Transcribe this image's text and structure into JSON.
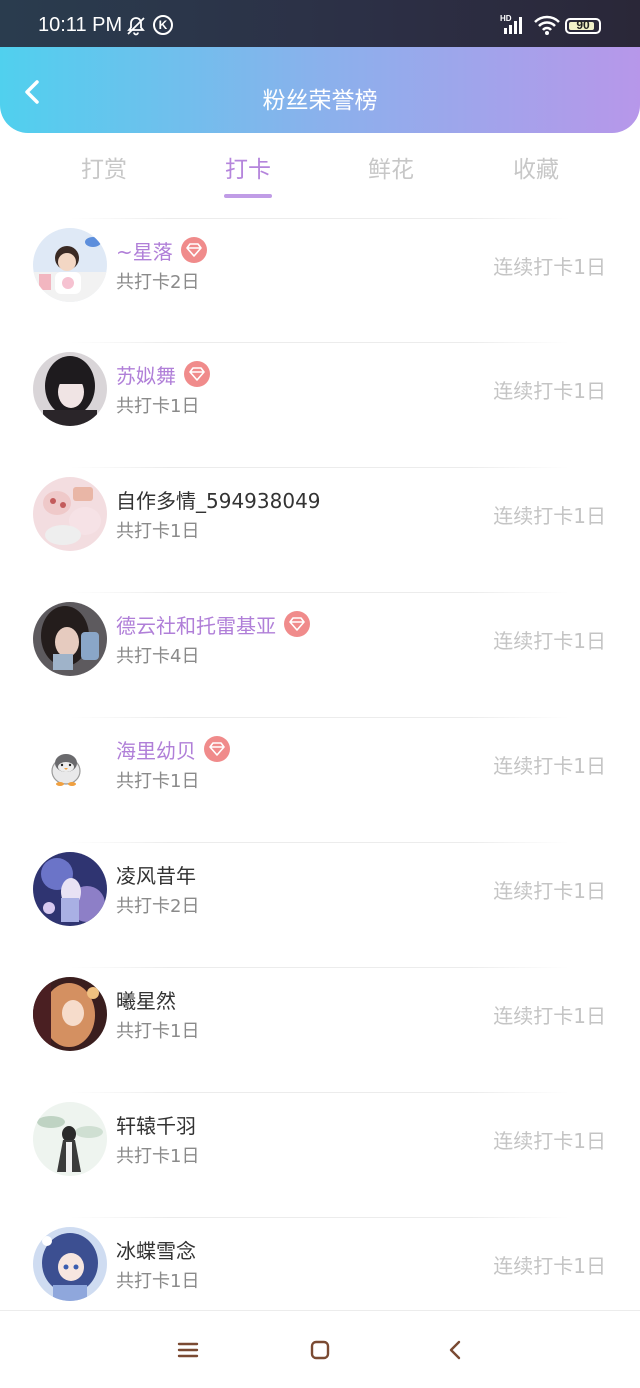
{
  "status_bar": {
    "time": "10:11 PM",
    "k_label": "K",
    "battery_pct": "90",
    "battery_level": 0.9,
    "icons": [
      "bell-off-icon",
      "k-circle-icon",
      "hd-signal-icon",
      "wifi-icon",
      "battery-icon"
    ]
  },
  "header": {
    "title": "粉丝荣誉榜",
    "back_icon": "chevron-left-icon"
  },
  "tabs": [
    {
      "label": "打赏",
      "active": false
    },
    {
      "label": "打卡",
      "active": true
    },
    {
      "label": "鲜花",
      "active": false
    },
    {
      "label": "收藏",
      "active": false
    }
  ],
  "list": [
    {
      "name": "~星落",
      "vip": true,
      "total": "共打卡2日",
      "streak": "连续打卡1日"
    },
    {
      "name": "苏姒舞",
      "vip": true,
      "total": "共打卡1日",
      "streak": "连续打卡1日"
    },
    {
      "name": "自作多情_594938049",
      "vip": false,
      "total": "共打卡1日",
      "streak": "连续打卡1日"
    },
    {
      "name": "德云社和托雷基亚",
      "vip": true,
      "total": "共打卡4日",
      "streak": "连续打卡1日"
    },
    {
      "name": "海里幼贝",
      "vip": true,
      "total": "共打卡1日",
      "streak": "连续打卡1日"
    },
    {
      "name": "凌风昔年",
      "vip": false,
      "total": "共打卡2日",
      "streak": "连续打卡1日"
    },
    {
      "name": "曦星然",
      "vip": false,
      "total": "共打卡1日",
      "streak": "连续打卡1日"
    },
    {
      "name": "轩辕千羽",
      "vip": false,
      "total": "共打卡1日",
      "streak": "连续打卡1日"
    },
    {
      "name": "冰蝶雪念",
      "vip": false,
      "total": "共打卡1日",
      "streak": "连续打卡1日"
    }
  ],
  "colors": {
    "accent": "#b585dc",
    "vip_name": "#b07fd8",
    "gem_badge": "#f08b8b",
    "header_gradient_start": "#50d0ee",
    "header_gradient_end": "#b797ea"
  },
  "navbar": {
    "icons": [
      "menu-icon",
      "home-square-icon",
      "back-triangle-icon"
    ]
  }
}
